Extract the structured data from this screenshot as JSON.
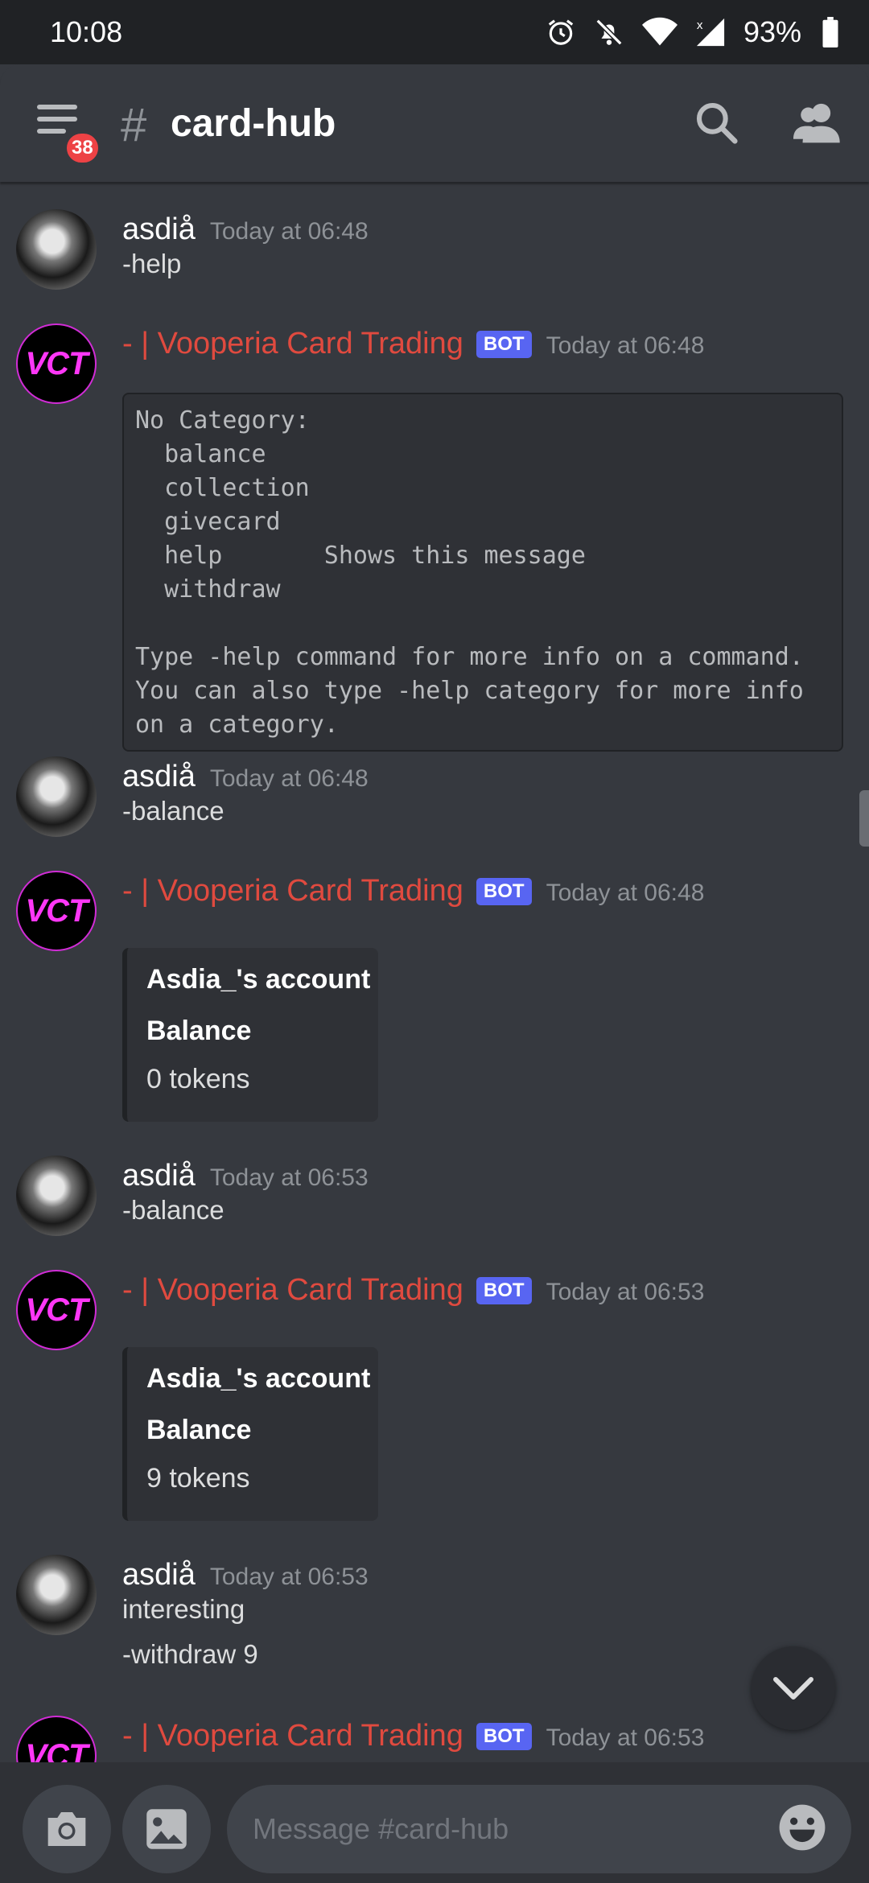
{
  "status_bar": {
    "time": "10:08",
    "battery": "93%"
  },
  "header": {
    "badge": "38",
    "hash": "#",
    "channel": "card-hub"
  },
  "messages": [
    {
      "author": "asdiå",
      "time": "Today at 06:48",
      "lines": [
        "-help"
      ]
    },
    {
      "author": "- | Vooperia Card Trading",
      "tag": "BOT",
      "time": "Today at 06:48",
      "code": "No Category:\n  balance\n  collection\n  givecard\n  help       Shows this message\n  withdraw\n\nType -help command for more info on a command.\nYou can also type -help category for more info\non a category."
    },
    {
      "author": "asdiå",
      "time": "Today at 06:48",
      "lines": [
        "-balance"
      ]
    },
    {
      "author": "- | Vooperia Card Trading",
      "tag": "BOT",
      "time": "Today at 06:48",
      "embed": {
        "title": "Asdia_'s account",
        "field": "Balance",
        "value": "0 tokens"
      }
    },
    {
      "author": "asdiå",
      "time": "Today at 06:53",
      "lines": [
        "-balance"
      ]
    },
    {
      "author": "- | Vooperia Card Trading",
      "tag": "BOT",
      "time": "Today at 06:53",
      "embed": {
        "title": "Asdia_'s account",
        "field": "Balance",
        "value": "9 tokens"
      }
    },
    {
      "author": "asdiå",
      "time": "Today at 06:53",
      "lines": [
        "interesting",
        "-withdraw 9"
      ]
    },
    {
      "author": "- | Vooperia Card Trading",
      "tag": "BOT",
      "time": "Today at 06:53"
    }
  ],
  "bot_avatar_text": "VCT",
  "composer": {
    "placeholder": "Message #card-hub"
  },
  "icons": [
    "menu-icon",
    "search-icon",
    "members-icon",
    "camera-icon",
    "image-icon",
    "emoji-icon",
    "chevron-down-icon",
    "alarm-icon",
    "bell-off-icon",
    "wifi-icon",
    "signal-icon",
    "battery-icon"
  ]
}
